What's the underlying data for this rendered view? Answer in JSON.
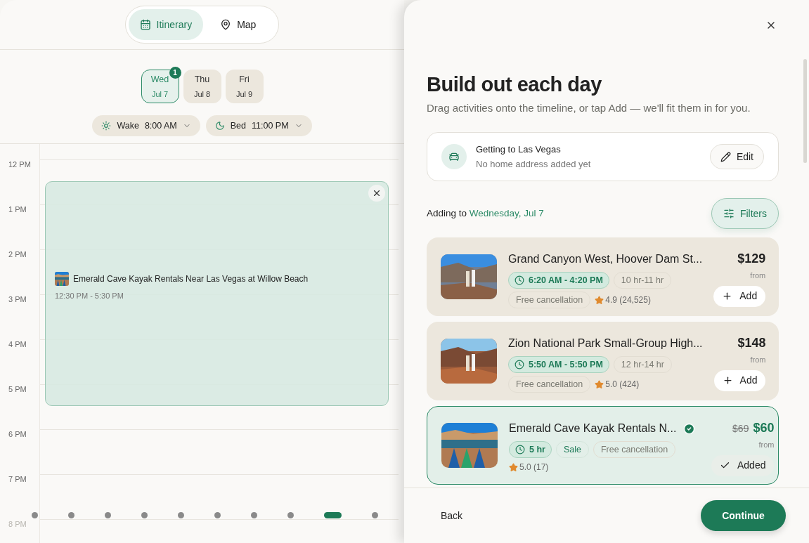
{
  "view_tabs": [
    {
      "label": "Itinerary",
      "selected": true
    },
    {
      "label": "Map",
      "selected": false
    }
  ],
  "days": [
    {
      "weekday": "Wed",
      "date": "Jul 7",
      "selected": true,
      "badge": "1"
    },
    {
      "weekday": "Thu",
      "date": "Jul 8",
      "selected": false
    },
    {
      "weekday": "Fri",
      "date": "Jul 9",
      "selected": false
    }
  ],
  "wake": {
    "label": "Wake",
    "time": "8:00 AM"
  },
  "bed": {
    "label": "Bed",
    "time": "11:00 PM"
  },
  "timeline": {
    "hours": [
      "12 PM",
      "1 PM",
      "2 PM",
      "3 PM",
      "4 PM",
      "5 PM",
      "6 PM",
      "7 PM",
      "8 PM"
    ],
    "event": {
      "title": "Emerald Cave Kayak Rentals Near Las Vegas at Willow Beach",
      "time": "12:30 PM - 5:30 PM"
    }
  },
  "pager": [
    {
      "selected": false
    },
    {
      "selected": false
    },
    {
      "selected": false
    },
    {
      "selected": false
    },
    {
      "selected": false
    },
    {
      "selected": false
    },
    {
      "selected": false
    },
    {
      "selected": false
    },
    {
      "selected": true
    },
    {
      "selected": false
    }
  ],
  "panel": {
    "title": "Build out each day",
    "subtitle": "Drag activities onto the timeline, or tap Add — we'll fit them in for you.",
    "travel": {
      "title": "Getting to Las Vegas",
      "subtitle": "No home address added yet",
      "button": "Edit"
    },
    "adding": {
      "prefix": "Adding to",
      "day": "Wednesday, Jul 7"
    },
    "filters": "Filters",
    "activities": [
      {
        "title": "Grand Canyon West, Hoover Dam St...",
        "chips": [
          {
            "text": "6:20 AM - 4:20 PM",
            "kind": "time"
          },
          {
            "text": "10 hr-11 hr",
            "kind": "plain"
          },
          {
            "text": "Free cancellation",
            "kind": "plain"
          }
        ],
        "rating": "4.9 (24,525)",
        "price": "$129",
        "from": "from",
        "action": "Add",
        "added": false
      },
      {
        "title": "Zion National Park Small-Group High...",
        "chips": [
          {
            "text": "5:50 AM - 5:50 PM",
            "kind": "time"
          },
          {
            "text": "12 hr-14 hr",
            "kind": "plain"
          },
          {
            "text": "Free cancellation",
            "kind": "plain"
          }
        ],
        "rating": "5.0 (424)",
        "price": "$148",
        "from": "from",
        "action": "Add",
        "added": false
      },
      {
        "title": "Emerald Cave Kayak Rentals N...",
        "chips": [
          {
            "text": "5 hr",
            "kind": "time"
          },
          {
            "text": "Sale",
            "kind": "sale"
          },
          {
            "text": "Free cancellation",
            "kind": "plain"
          }
        ],
        "rating": "5.0 (17)",
        "old_price": "$69",
        "price": "$60",
        "from": "from",
        "action": "Added",
        "added": true
      }
    ]
  },
  "footer": {
    "back": "Back",
    "continue": "Continue"
  }
}
